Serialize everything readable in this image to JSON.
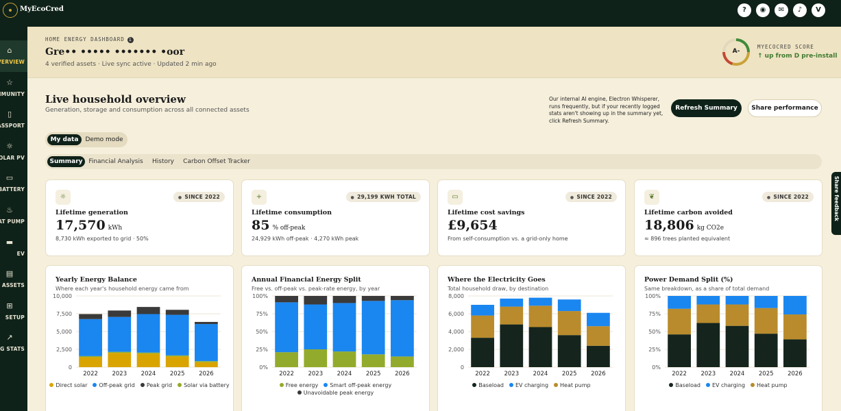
{
  "app": {
    "name": "MyEcoCred"
  },
  "topbar": {
    "icons": [
      {
        "name": "help-icon",
        "glyph": "?"
      },
      {
        "name": "compass-icon",
        "glyph": "◉"
      },
      {
        "name": "chat-icon",
        "glyph": "✉"
      },
      {
        "name": "bell-icon",
        "glyph": "♪"
      }
    ],
    "avatar": "V"
  },
  "sidebar": {
    "items": [
      {
        "name": "home-icon",
        "glyph": "⌂",
        "label": "OVERVIEW",
        "active": true
      },
      {
        "name": "trophy-icon",
        "glyph": "☆",
        "label": "COMMUNITY"
      },
      {
        "name": "passport-icon",
        "glyph": "▯",
        "label": "PASSPORT"
      },
      {
        "name": "sun-icon",
        "glyph": "☼",
        "label": "SOLAR PV"
      },
      {
        "name": "battery-icon",
        "glyph": "▭",
        "label": "BATTERY"
      },
      {
        "name": "heat-pump-icon",
        "glyph": "♨",
        "label": "HEAT PUMP"
      },
      {
        "name": "car-icon",
        "glyph": "▬",
        "label": "EV"
      },
      {
        "name": "assets-icon",
        "glyph": "▤",
        "label": "ASSETS"
      },
      {
        "name": "setup-icon",
        "glyph": "⊞",
        "label": "SETUP"
      },
      {
        "name": "stats-icon",
        "glyph": "↗",
        "label": "LOG STATS"
      }
    ]
  },
  "header": {
    "eyebrow": "HOME ENERGY DASHBOARD",
    "info": "i",
    "house_name": "Gre•• ••••• ••••••• •oor",
    "meta": "4 verified assets · Live sync active · Updated 2 min ago",
    "score_label": "MYECOCRED SCORE",
    "score_value": "A-",
    "score_change": "↑ up from D pre-install"
  },
  "overview": {
    "title": "Live household overview",
    "subtitle": "Generation, storage and consumption across all connected assets",
    "ai_note": "Our internal AI engine, Electron Whisperer, runs frequently, but if your recently logged stats aren't showing up in the summary yet, click Refresh Summary.",
    "refresh_label": "Refresh Summary",
    "share_label": "Share performance"
  },
  "mode_toggle": {
    "options": [
      "My data",
      "Demo mode"
    ]
  },
  "tabs": [
    "Summary",
    "Financial Analysis",
    "History",
    "Carbon Offset Tracker"
  ],
  "stats": [
    {
      "icon": "sun-icon",
      "glyph": "☼",
      "badge": "SINCE 2022",
      "title": "Lifetime generation",
      "value": "17,570",
      "unit": "kWh",
      "sub": "8,730 kWh exported to grid · 50%"
    },
    {
      "icon": "plus-icon",
      "glyph": "+",
      "badge": "29,199 KWH TOTAL",
      "title": "Lifetime consumption",
      "value": "85",
      "unit": "% off-peak",
      "sub": "24,929 kWh off-peak · 4,270 kWh peak"
    },
    {
      "icon": "wallet-icon",
      "glyph": "▭",
      "badge": "SINCE 2022",
      "title": "Lifetime cost savings",
      "value": "£9,654",
      "unit": "",
      "sub": "From self-consumption vs. a grid-only home"
    },
    {
      "icon": "leaf-icon",
      "glyph": "❦",
      "badge": "SINCE 2022",
      "title": "Lifetime carbon avoided",
      "value": "18,806",
      "unit": "kg CO2e",
      "sub": "≈ 896 trees planted equivalent"
    }
  ],
  "feedback": {
    "label": "Share feedback"
  },
  "chart_data": [
    {
      "type": "bar",
      "stacked": true,
      "title": "Yearly Energy Balance",
      "subtitle": "Where each year's household energy came from",
      "categories": [
        "2022",
        "2023",
        "2024",
        "2025",
        "2026"
      ],
      "yticks": [
        "10,000",
        "7,500",
        "5,000",
        "2,500",
        "0"
      ],
      "ylim": [
        0,
        10000
      ],
      "series": [
        {
          "name": "Direct solar",
          "color": "#d9a400",
          "values": [
            1400,
            2000,
            1900,
            1500,
            700
          ]
        },
        {
          "name": "Solar via battery",
          "color": "#93ab2c",
          "values": [
            150,
            150,
            150,
            150,
            150
          ]
        },
        {
          "name": "Off-peak grid",
          "color": "#1a86f0",
          "values": [
            5200,
            4900,
            5400,
            5700,
            5200
          ]
        },
        {
          "name": "Peak grid",
          "color": "#3a3a3a",
          "values": [
            700,
            900,
            1000,
            700,
            300
          ]
        }
      ],
      "legend": [
        "Direct solar",
        "Off-peak grid",
        "Peak grid",
        "Solar via battery"
      ]
    },
    {
      "type": "bar",
      "stacked": true,
      "title": "Annual Financial Energy Split",
      "subtitle": "Free vs. off-peak vs. peak-rate energy, by year",
      "categories": [
        "2022",
        "2023",
        "2024",
        "2025",
        "2026"
      ],
      "yticks": [
        "100%",
        "75%",
        "50%",
        "25%",
        "0%"
      ],
      "ylim": [
        0,
        100
      ],
      "series": [
        {
          "name": "Free energy",
          "color": "#93ab2c",
          "values": [
            21,
            25,
            22,
            18,
            15
          ]
        },
        {
          "name": "Smart off-peak energy",
          "color": "#1a86f0",
          "values": [
            70,
            63,
            68,
            75,
            79
          ]
        },
        {
          "name": "Unavoidable peak energy",
          "color": "#3a3a3a",
          "values": [
            9,
            12,
            10,
            7,
            6
          ]
        }
      ],
      "legend": [
        "Free energy",
        "Smart off-peak energy",
        "Unavoidable peak energy"
      ]
    },
    {
      "type": "bar",
      "stacked": true,
      "title": "Where the Electricity Goes",
      "subtitle": "Total household draw, by destination",
      "categories": [
        "2022",
        "2023",
        "2024",
        "2025",
        "2026"
      ],
      "yticks": [
        "8,000",
        "6,000",
        "4,000",
        "2,000",
        "0"
      ],
      "ylim": [
        0,
        8000
      ],
      "series": [
        {
          "name": "Baseload",
          "color": "#15251d",
          "values": [
            3300,
            4800,
            4500,
            3600,
            2400
          ]
        },
        {
          "name": "Heat pump",
          "color": "#b98b2c",
          "values": [
            2500,
            2000,
            2400,
            2700,
            2200
          ]
        },
        {
          "name": "EV charging",
          "color": "#1a86f0",
          "values": [
            1200,
            900,
            900,
            1300,
            1500
          ]
        }
      ],
      "legend": [
        "Baseload",
        "EV charging",
        "Heat pump"
      ]
    },
    {
      "type": "bar",
      "stacked": true,
      "title": "Power Demand Split (%)",
      "subtitle": "Same breakdown, as a share of total demand",
      "categories": [
        "2022",
        "2023",
        "2024",
        "2025",
        "2026"
      ],
      "yticks": [
        "100%",
        "75%",
        "50%",
        "25%",
        "0%"
      ],
      "ylim": [
        0,
        100
      ],
      "series": [
        {
          "name": "Baseload",
          "color": "#15251d",
          "values": [
            46,
            62,
            58,
            47,
            39
          ]
        },
        {
          "name": "Heat pump",
          "color": "#b98b2c",
          "values": [
            36,
            26,
            30,
            36,
            35
          ]
        },
        {
          "name": "EV charging",
          "color": "#1a86f0",
          "values": [
            18,
            12,
            12,
            17,
            26
          ]
        }
      ],
      "legend": [
        "Baseload",
        "EV charging",
        "Heat pump"
      ]
    }
  ]
}
